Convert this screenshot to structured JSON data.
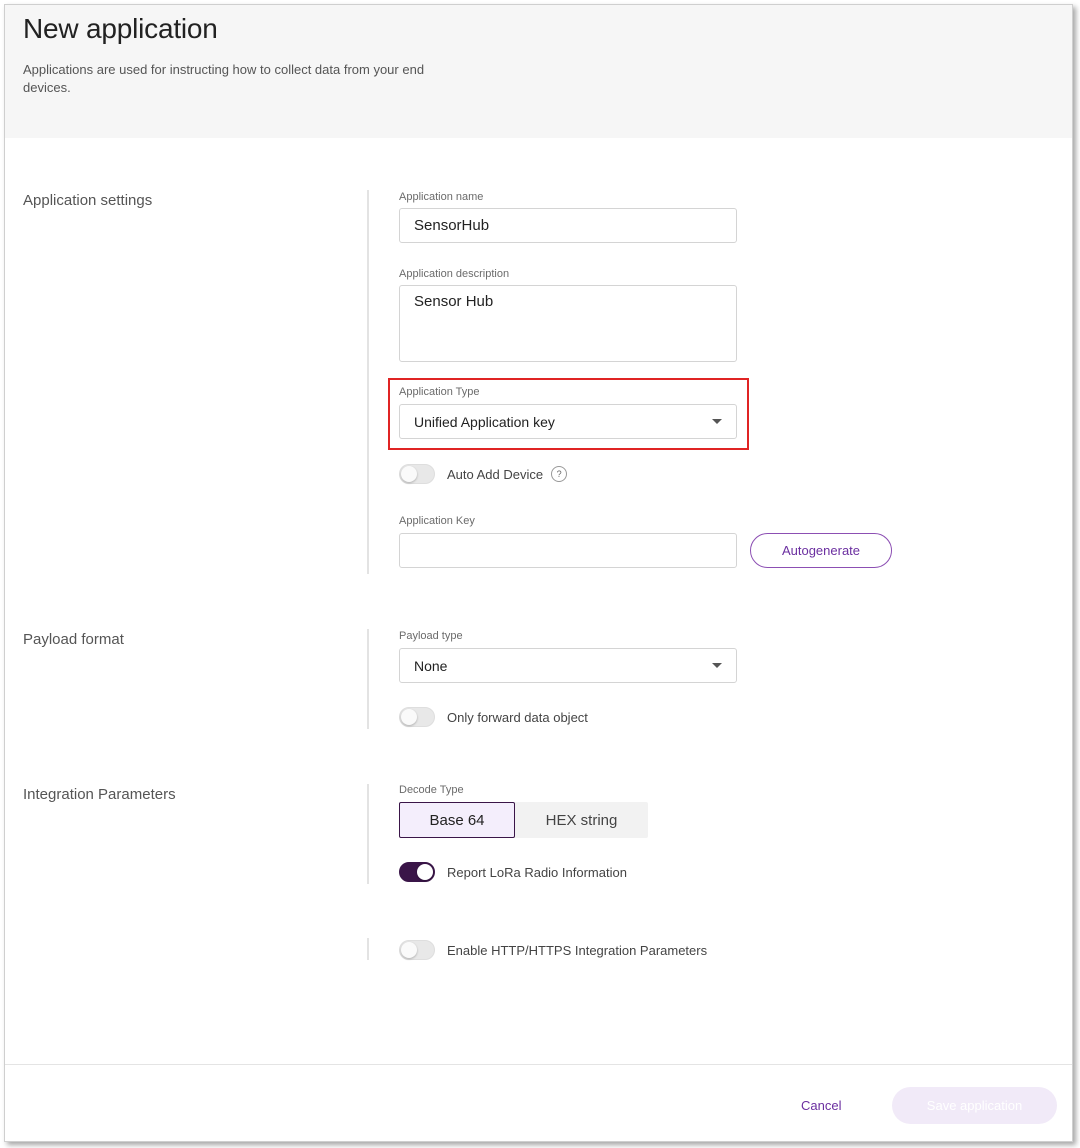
{
  "header": {
    "title": "New application",
    "subtitle": "Applications are used for instructing how to collect data from your end devices."
  },
  "sections": {
    "application_settings": "Application settings",
    "payload_format": "Payload format",
    "integration_parameters": "Integration Parameters"
  },
  "application_name": {
    "label": "Application name",
    "value": "SensorHub"
  },
  "application_description": {
    "label": "Application description",
    "value": "Sensor Hub"
  },
  "application_type": {
    "label": "Application Type",
    "value": "Unified Application key"
  },
  "auto_add_device": {
    "label": "Auto Add Device",
    "enabled": false,
    "help": "?"
  },
  "application_key": {
    "label": "Application Key",
    "value": "",
    "autogenerate_label": "Autogenerate"
  },
  "payload_type": {
    "label": "Payload type",
    "value": "None"
  },
  "only_forward": {
    "label": "Only forward data object",
    "enabled": false
  },
  "decode_type": {
    "label": "Decode Type",
    "options": [
      "Base 64",
      "HEX string"
    ],
    "selected": "Base 64"
  },
  "report_lora": {
    "label": "Report LoRa Radio Information",
    "enabled": true
  },
  "enable_http": {
    "label": "Enable HTTP/HTTPS Integration Parameters",
    "enabled": false
  },
  "footer": {
    "cancel_label": "Cancel",
    "save_label": "Save application"
  },
  "colors": {
    "accent": "#3a1548",
    "link": "#6b2fa0",
    "highlight": "#e02424"
  }
}
